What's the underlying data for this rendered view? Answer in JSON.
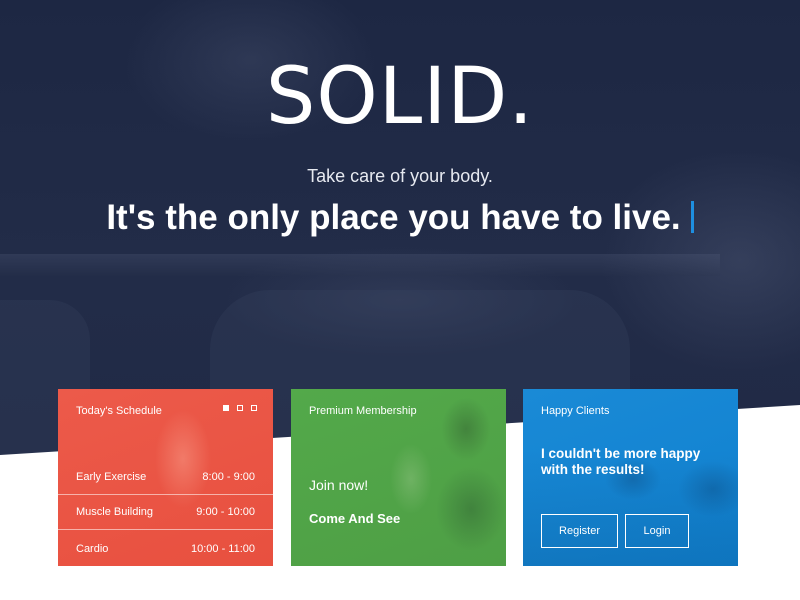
{
  "hero": {
    "logo": "SOLID.",
    "tagline_small": "Take care of your body.",
    "tagline_big": "It's the only place you have to live.",
    "cursor_color": "#1e8fe0",
    "background_color": "#1f2844"
  },
  "schedule_card": {
    "title": "Today's Schedule",
    "color": "#e8503f",
    "slider_dots": 3,
    "active_dot": 1,
    "rows": [
      {
        "name": "Early Exercise",
        "time": "8:00 - 9:00"
      },
      {
        "name": "Muscle Building",
        "time": "9:00 - 10:00"
      },
      {
        "name": "Cardio",
        "time": "10:00 - 11:00"
      }
    ]
  },
  "membership_card": {
    "title": "Premium Membership",
    "color": "#4e9f45",
    "join_text": "Join now!",
    "cta_text": "Come And See"
  },
  "clients_card": {
    "title": "Happy Clients",
    "color": "#0f80cf",
    "quote": "I couldn't be more happy with the results!",
    "register_label": "Register",
    "login_label": "Login"
  }
}
